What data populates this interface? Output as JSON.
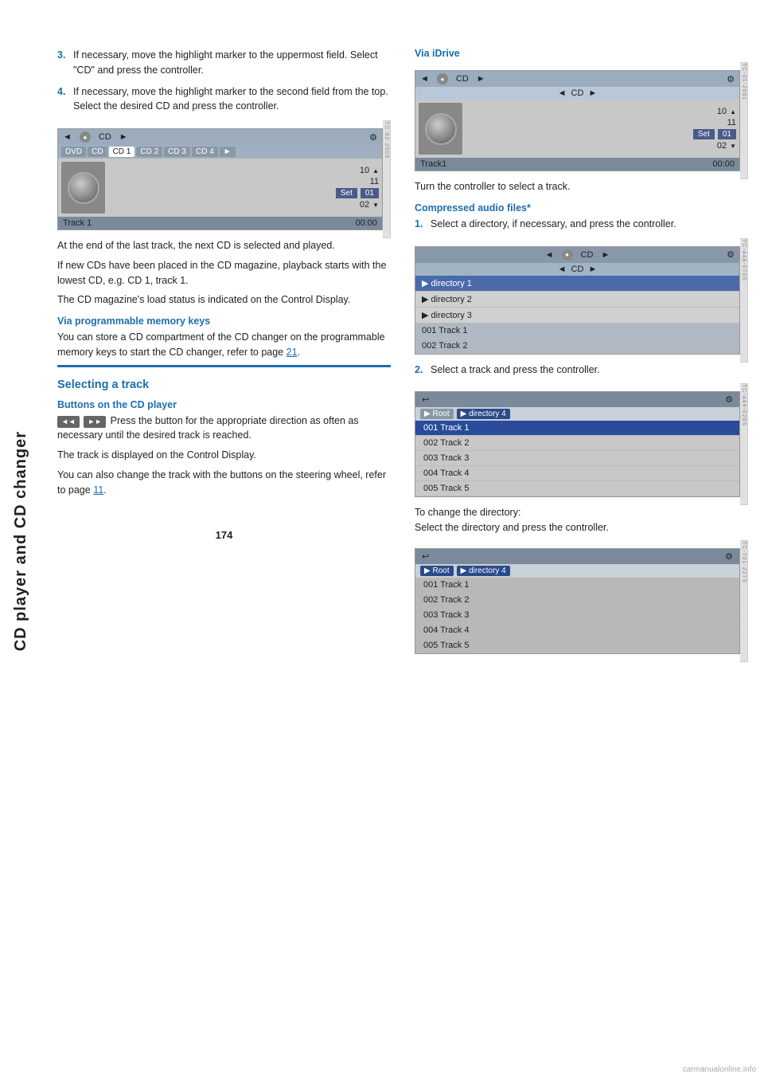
{
  "sidebar": {
    "label": "CD player and CD changer"
  },
  "page_number": "174",
  "watermark": "carmanualonline.info",
  "left_col": {
    "steps": [
      {
        "num": "3.",
        "text": "If necessary, move the highlight marker to the uppermost field. Select \"CD\" and press the controller."
      },
      {
        "num": "4.",
        "text": "If necessary, move the highlight marker to the second field from the top. Select the desired CD and press the controller."
      }
    ],
    "cd_screen_1": {
      "topbar": "◄ ● CD ►",
      "tab_row": [
        "DVD",
        "CD",
        "CD 1",
        "CD 2",
        "CD 3",
        "CD 4",
        "►"
      ],
      "active_tab": "CD 1",
      "tracks": [
        "10",
        "11",
        "01",
        "02"
      ],
      "set_label": "Set",
      "footer_left": "Track 1",
      "footer_right": "00:00"
    },
    "paragraphs": [
      "At the end of the last track, the next CD is selected and played.",
      "If new CDs have been placed in the CD magazine, playback starts with the lowest CD, e.g. CD 1, track 1.",
      "The CD magazine's load status is indicated on the Control Display."
    ],
    "via_prog_memory": {
      "heading": "Via programmable memory keys",
      "text": "You can store a CD compartment of the CD changer on the programmable memory keys to start the CD changer, refer to page",
      "page_link": "21",
      "text_after": "."
    },
    "selecting_track": {
      "heading": "Selecting a track",
      "buttons_heading": "Buttons on the CD player",
      "buttons_text": "Press the button for the appropriate direction as often as necessary until the desired track is reached.",
      "body1": "The track is displayed on the Control Display.",
      "body2": "You can also change the track with the buttons on the steering wheel, refer to page",
      "page_link": "11",
      "body2_after": "."
    }
  },
  "right_col": {
    "via_idrive": {
      "heading": "Via iDrive",
      "screen": {
        "topbar": "◄ ● CD ►",
        "sub_topbar": "◄ CD ►",
        "tracks": [
          "10",
          "11",
          "01",
          "02"
        ],
        "set_label": "Set",
        "footer_left": "Track1",
        "footer_right": "00:00"
      },
      "instruction": "Turn the controller to select a track."
    },
    "compressed_audio": {
      "heading": "Compressed audio files*",
      "steps": [
        {
          "num": "1.",
          "text": "Select a directory, if necessary, and press the controller."
        },
        {
          "num": "2.",
          "text": "Select a track and press the controller."
        }
      ],
      "screen1": {
        "topbar": "◄ ● CD ►",
        "sub_topbar": "◄ CD ►",
        "items": [
          {
            "label": "▶ directory 1",
            "highlighted": true
          },
          {
            "label": "▶ directory 2",
            "highlighted": false
          },
          {
            "label": "▶ directory 3",
            "highlighted": false
          },
          {
            "label": "001 Track  1",
            "highlighted": false
          },
          {
            "label": "002 Track  2",
            "highlighted": false
          }
        ]
      },
      "screen2": {
        "back_icon": "↩",
        "breadcrumbs": [
          "▶ Root",
          "▶ directory 4"
        ],
        "items": [
          {
            "label": "001 Track  1",
            "highlighted": true
          },
          {
            "label": "002 Track  2",
            "highlighted": false
          },
          {
            "label": "003 Track  3",
            "highlighted": false
          },
          {
            "label": "004 Track  4",
            "highlighted": false
          },
          {
            "label": "005 Track  5",
            "highlighted": false
          }
        ]
      },
      "change_directory_text": "To change the directory:",
      "change_directory_instruction": "Select the directory and press the controller.",
      "screen3": {
        "back_icon": "↩",
        "breadcrumbs": [
          "▶ Root",
          "▶ directory 4"
        ],
        "items": [
          {
            "label": "001 Track  1",
            "highlighted": false
          },
          {
            "label": "002 Track  2",
            "highlighted": false
          },
          {
            "label": "003 Track  3",
            "highlighted": false
          },
          {
            "label": "004 Track  4",
            "highlighted": false
          },
          {
            "label": "005 Track  5",
            "highlighted": false
          }
        ]
      }
    }
  }
}
